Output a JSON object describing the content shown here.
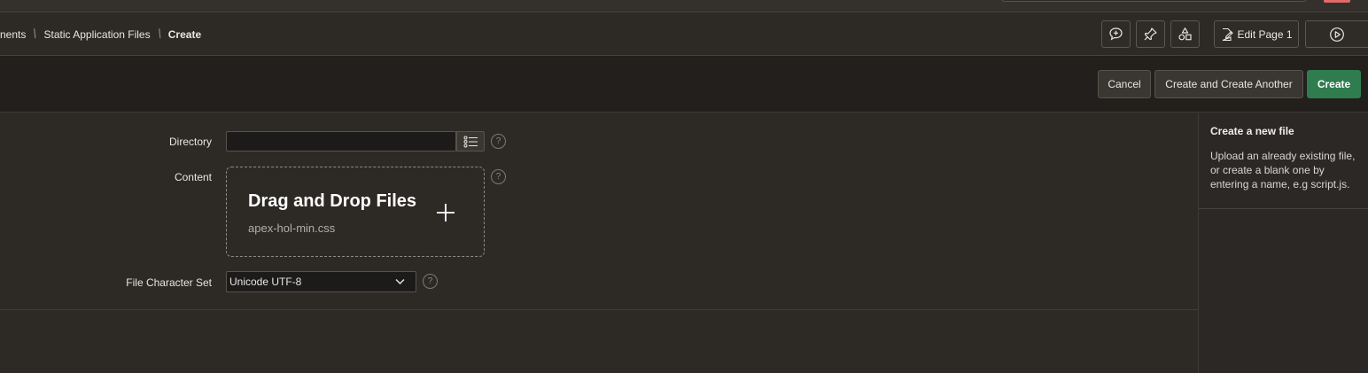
{
  "breadcrumb": {
    "items": [
      "nents",
      "Static Application Files",
      "Create"
    ]
  },
  "toolbar": {
    "edit_page_label": "Edit Page 1",
    "icons": [
      "comment-add-icon",
      "pin-icon",
      "shapes-icon",
      "edit-page-icon",
      "run-icon"
    ]
  },
  "actions": {
    "cancel_label": "Cancel",
    "create_another_label": "Create and Create Another",
    "create_label": "Create",
    "primary_color": "#2f7d4f"
  },
  "form": {
    "directory": {
      "label": "Directory",
      "value": ""
    },
    "content": {
      "label": "Content",
      "dropzone_title": "Drag and Drop Files",
      "file_name": "apex-hol-min.css"
    },
    "charset": {
      "label": "File Character Set",
      "value": "Unicode UTF-8"
    },
    "help_glyph": "?"
  },
  "help_panel": {
    "title": "Create a new file",
    "text": "Upload an already existing file, or create a blank one by entering a name, e.g script.js."
  }
}
